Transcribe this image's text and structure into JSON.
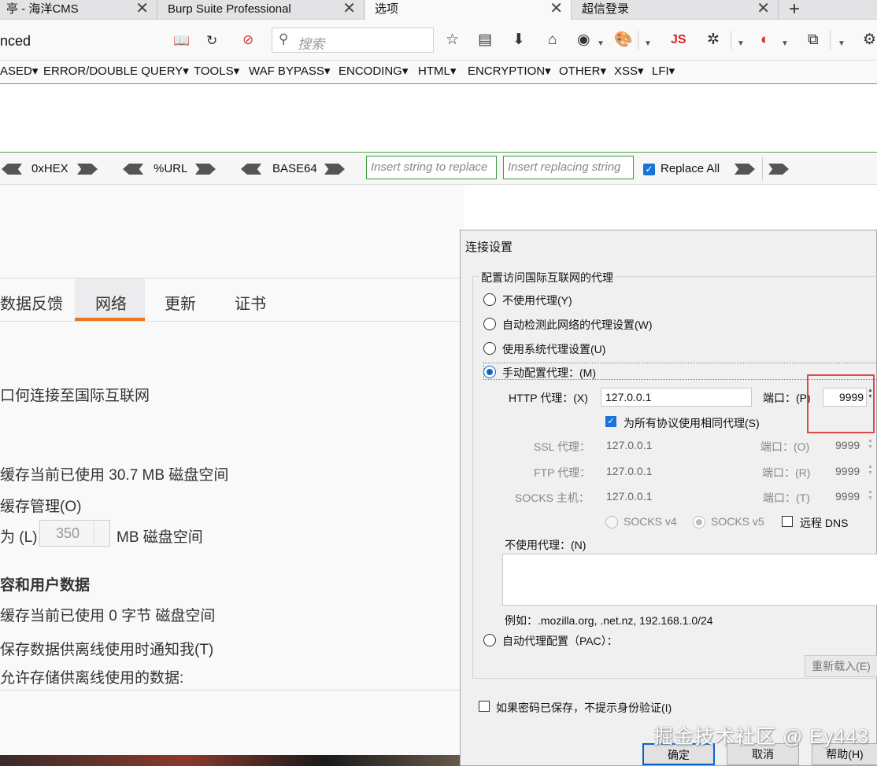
{
  "tabs": [
    {
      "title": "亭 - 海洋CMS"
    },
    {
      "title": "Burp Suite Professional"
    },
    {
      "title": "选项"
    },
    {
      "title": "超信登录"
    }
  ],
  "tab_close_glyph": "✕",
  "new_tab_glyph": "+",
  "navbar": {
    "url": "nced",
    "search_placeholder": "搜索",
    "js_label": "JS"
  },
  "hackbar": {
    "menu": [
      "ASED▾",
      "ERROR/DOUBLE QUERY▾",
      "TOOLS▾",
      "WAF BYPASS▾",
      "ENCODING▾",
      "HTML▾",
      "ENCRYPTION▾",
      "OTHER▾",
      "XSS▾",
      "LFI▾"
    ],
    "encoders": [
      "0xHEX",
      "%URL",
      "BASE64"
    ],
    "insert_placeholder": "Insert string to replace",
    "replacing_placeholder": "Insert replacing string",
    "replace_all": "Replace All"
  },
  "prefs": {
    "tabs": [
      "数据反馈",
      "网络",
      "更新",
      "证书"
    ],
    "active_tab": "网络",
    "connect_text": "口何连接至国际互联网",
    "cache_used": "缓存当前已使用 30.7 MB 磁盘空间",
    "cache_manage": "缓存管理(O)",
    "limit_prefix": "为 (L)",
    "limit_value": "350",
    "limit_suffix": "MB 磁盘空间",
    "offline_heading": "容和用户数据",
    "offline_used": "缓存当前已使用 0 字节 磁盘空间",
    "offline_notify": "保存数据供离线使用时通知我(T)",
    "offline_allow": "允许存储供离线使用的数据:"
  },
  "dialog": {
    "title": "连接设置",
    "group_label": "配置访问国际互联网的代理",
    "no_proxy": "不使用代理(Y)",
    "auto_detect": "自动检测此网络的代理设置(W)",
    "system_proxy": "使用系统代理设置(U)",
    "manual_proxy": "手动配置代理：(M)",
    "http_label": "HTTP 代理：(X)",
    "http_value": "127.0.0.1",
    "port_label_p": "端口：(P)",
    "http_port": "9999",
    "same_proxy": "为所有协议使用相同代理(S)",
    "ssl_label": "SSL 代理：",
    "ssl_value": "127.0.0.1",
    "port_label_o": "端口：(O)",
    "ssl_port": "9999",
    "ftp_label": "FTP 代理：",
    "ftp_value": "127.0.0.1",
    "port_label_r": "端口：(R)",
    "ftp_port": "9999",
    "socks_label": "SOCKS 主机：",
    "socks_value": "127.0.0.1",
    "port_label_t": "端口：(T)",
    "socks_port": "9999",
    "socks_v4": "SOCKS v4",
    "socks_v5": "SOCKS v5",
    "remote_dns": "远程 DNS",
    "no_proxy_for": "不使用代理：(N)",
    "example": "例如：.mozilla.org, .net.nz, 192.168.1.0/24",
    "pac": "自动代理配置（PAC）：",
    "reload": "重新载入(E)",
    "no_auth_prompt": "如果密码已保存，不提示身份验证(I)",
    "ok": "确定",
    "cancel": "取消",
    "help": "帮助(H)"
  },
  "watermark": "掘金技术社区 @ Ey443",
  "colors": {
    "accent_orange": "#e87722",
    "highlight_red": "#e0494b",
    "check_blue": "#1a73d9",
    "hackbar_green": "#4caf50"
  }
}
